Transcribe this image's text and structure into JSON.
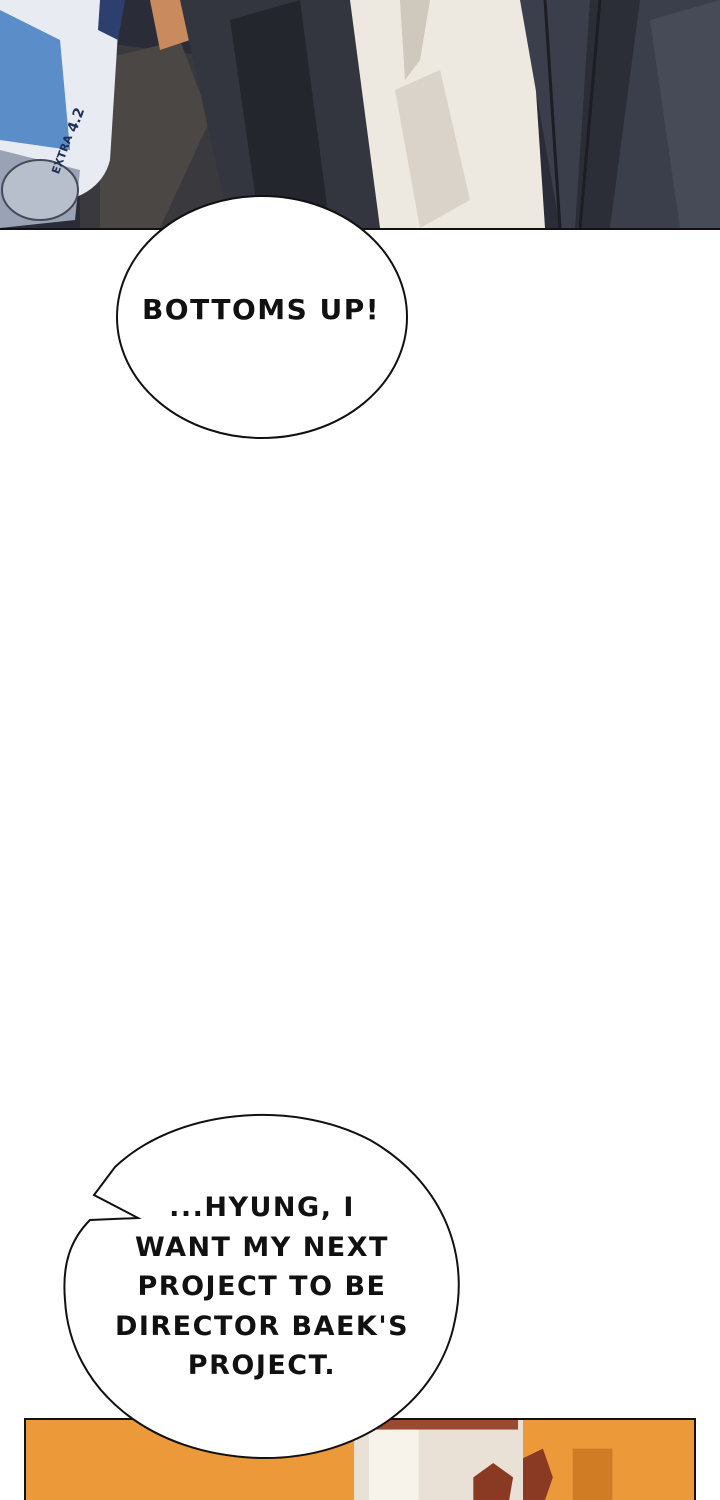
{
  "speech_bubbles": [
    {
      "lines": [
        "BOTTOMS UP!"
      ]
    },
    {
      "lines": [
        "...HYUNG, I",
        "WANT MY NEXT",
        "PROJECT TO BE",
        "DIRECTOR BAEK'S",
        "PROJECT."
      ]
    }
  ],
  "top_panel": {
    "can_label": "4.2",
    "can_label_2": "EXTRA"
  },
  "colors": {
    "bubble_fill": "#ffffff",
    "bubble_stroke": "#111111",
    "suit_dark": "#2f323d",
    "shirt_light": "#ede8e0",
    "can_blue": "#5b8ec9",
    "bottom_panel_orange": "#e8922f"
  }
}
